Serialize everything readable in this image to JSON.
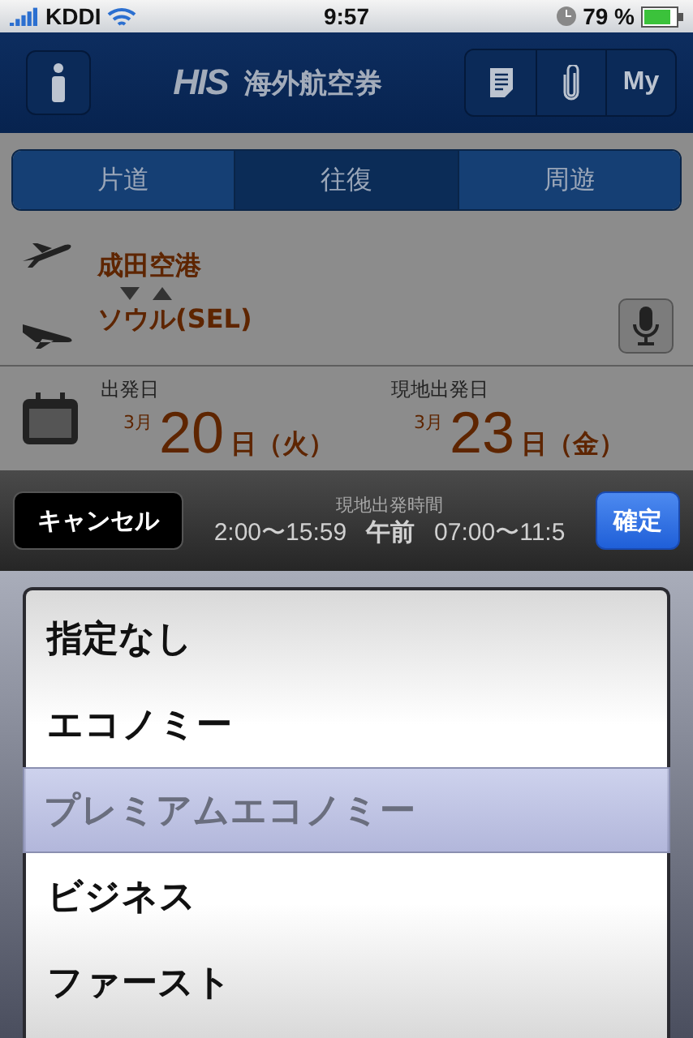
{
  "status_bar": {
    "carrier": "KDDI",
    "time": "9:57",
    "battery": "79 %"
  },
  "nav_bar": {
    "logo": "HIS",
    "title": "海外航空券",
    "buttons": [
      {
        "kind": "info"
      },
      {
        "kind": "doc"
      },
      {
        "kind": "clip"
      },
      {
        "kind": "text",
        "label": "My"
      }
    ]
  },
  "tabs": [
    {
      "label": "片道",
      "selected": false
    },
    {
      "label": "往復",
      "selected": true
    },
    {
      "label": "周遊",
      "selected": false
    }
  ],
  "route": {
    "from": "成田空港",
    "to": "ソウル(SEL)"
  },
  "dates": [
    {
      "label": "出発日",
      "month": "3月",
      "day": "20",
      "suffix": "日（火）"
    },
    {
      "label": "現地出発日",
      "month": "3月",
      "day": "23",
      "suffix": "日（金）"
    }
  ],
  "toolbar": {
    "cancel": "キャンセル",
    "confirm": "確定",
    "behind_label": "現地出発時間",
    "behind_texts": [
      "2:00〜15:59",
      "午前",
      "07:00〜11:5"
    ]
  },
  "picker": [
    {
      "label": "指定なし",
      "selected": false
    },
    {
      "label": "エコノミー",
      "selected": false
    },
    {
      "label": "プレミアムエコノミー",
      "selected": true
    },
    {
      "label": "ビジネス",
      "selected": false
    },
    {
      "label": "ファースト",
      "selected": false
    }
  ]
}
